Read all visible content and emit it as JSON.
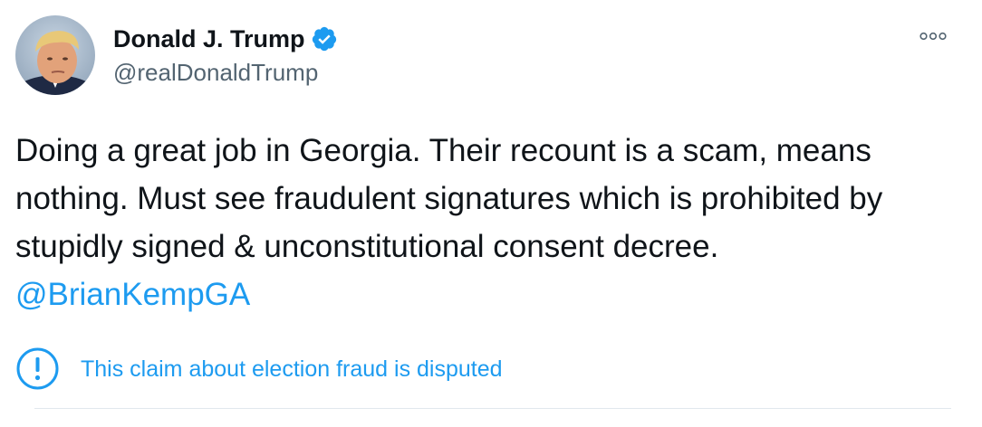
{
  "tweet": {
    "author": {
      "display_name": "Donald J. Trump",
      "handle": "@realDonaldTrump",
      "verified": true,
      "avatar_icon": "profile-photo"
    },
    "more_icon": "more-options-icon",
    "text_before_mention": "Doing a great job in Georgia. Their recount is a scam, means nothing. Must see fraudulent signatures which is prohibited by stupidly signed & unconstitutional consent decree. ",
    "mention": "@BrianKempGA",
    "notice": {
      "icon": "exclamation-circle-icon",
      "text": "This claim about election fraud is disputed"
    }
  },
  "colors": {
    "accent": "#1d9bf0",
    "text": "#0f1419",
    "secondary_text": "#536471",
    "divider": "#e1e8ed"
  }
}
